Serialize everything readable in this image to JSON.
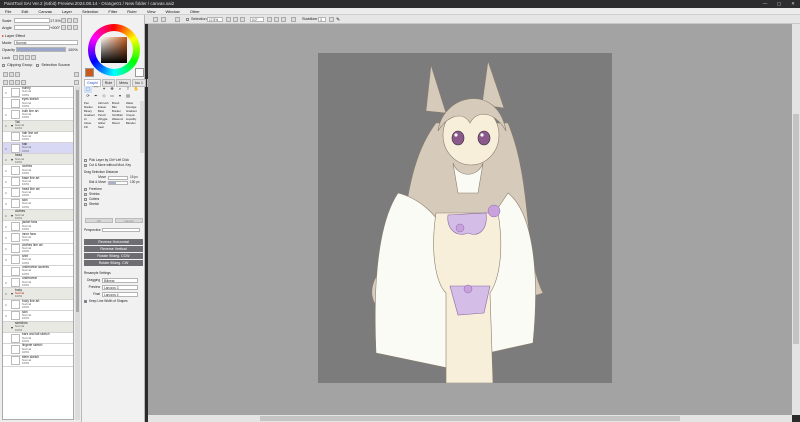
{
  "app": {
    "title": "PaintTool SAI Ver.2 (64bit) Preview.2024.08.14 - Orange01 / New folder / canvas.sai2"
  },
  "window_controls": {
    "minimize": "—",
    "maximize": "▢",
    "close": "✕"
  },
  "menu": [
    "File",
    "Edit",
    "Canvas",
    "Layer",
    "Selection",
    "Filter",
    "Ruler",
    "View",
    "Window",
    "Other"
  ],
  "toolbar": {
    "selection_label": "Selection",
    "zoom": "17.5%",
    "angle": "0.0°",
    "stabilizer_label": "Stabilizer",
    "stabilizer_value": "3"
  },
  "left_panel": {
    "rows": [
      {
        "label": "Scale",
        "value": "17.5%"
      },
      {
        "label": "Angle",
        "value": "+000°"
      }
    ],
    "layer_effect": "Layer Effect",
    "mode_label": "Mode",
    "mode_value": "Normal",
    "opacity_label": "Opacity",
    "opacity_value": "100%",
    "lock_label": "Lock",
    "clipping_group": "Clipping Group",
    "selection_source": "Selection Source",
    "layers": [
      {
        "name": "bunny",
        "mode": "Normal",
        "op": "100%",
        "type": "layer"
      },
      {
        "name": "eyes sketch",
        "mode": "Normal",
        "op": "100%",
        "type": "layer"
      },
      {
        "name": "bulb line art",
        "mode": "Normal",
        "op": "100%",
        "type": "layer"
      },
      {
        "name": "Tail",
        "mode": "Normal",
        "op": "100%",
        "type": "group"
      },
      {
        "name": "hair line art",
        "mode": "Normal",
        "op": "100%",
        "type": "layer"
      },
      {
        "name": "hair",
        "mode": "Normal",
        "op": "100%",
        "type": "selected"
      },
      {
        "name": "head",
        "mode": "Normal",
        "op": "100%",
        "type": "group"
      },
      {
        "name": "clothes",
        "mode": "Normal",
        "op": "100%",
        "type": "layer"
      },
      {
        "name": "base line art",
        "mode": "Normal",
        "op": "100%",
        "type": "layer"
      },
      {
        "name": "head line art",
        "mode": "Normal",
        "op": "100%",
        "type": "layer"
      },
      {
        "name": "skin",
        "mode": "Normal",
        "op": "100%",
        "type": "layer"
      },
      {
        "name": "clothes",
        "mode": "Normal",
        "op": "100%",
        "type": "group"
      },
      {
        "name": "jacket fans",
        "mode": "Normal",
        "op": "100%",
        "type": "layer"
      },
      {
        "name": "inner fans",
        "mode": "Normal",
        "op": "100%",
        "type": "layer"
      },
      {
        "name": "clothes line art",
        "mode": "Normal",
        "op": "100%",
        "type": "layer"
      },
      {
        "name": "shirt",
        "mode": "Normal",
        "op": "100%",
        "type": "layer"
      },
      {
        "name": "underwear accents",
        "mode": "Normal",
        "op": "100%",
        "type": "layer"
      },
      {
        "name": "underwear",
        "mode": "Normal",
        "op": "100%",
        "type": "layer"
      },
      {
        "name": "body",
        "mode": "Normal",
        "op": "100%",
        "type": "group_red"
      },
      {
        "name": "body line art",
        "mode": "Normal",
        "op": "100%",
        "type": "layer"
      },
      {
        "name": "skin",
        "mode": "Normal",
        "op": "100%",
        "type": "layer"
      },
      {
        "name": "sketches",
        "mode": "Normal",
        "op": "100%",
        "type": "group"
      },
      {
        "name": "ears and tail sketch",
        "mode": "Normal",
        "op": "100%",
        "type": "layer"
      },
      {
        "name": "lingerie sketch",
        "mode": "Normal",
        "op": "100%",
        "type": "layer"
      },
      {
        "name": "stem sketch",
        "mode": "Normal",
        "op": "100%",
        "type": "layer"
      }
    ]
  },
  "tool_panel": {
    "tabs": [
      "Graphi",
      "Rule",
      "Menu",
      "Inc 1",
      "Glide"
    ],
    "tools": [
      "Pen",
      "Airbrush",
      "Brush",
      "Water",
      "Marker",
      "Eraser",
      "Blur",
      "Smudge",
      "Binary",
      "Blow",
      "Bucket",
      "Gradient",
      "Gradient",
      "Pencil",
      "Scribbler",
      "Crayon",
      "Ai",
      "Wriggle",
      "Watercol",
      "Liquidify",
      "Close",
      "Glitter",
      "Mixed",
      "Blender",
      "Fill",
      "Seal"
    ],
    "pick_layer": "Pick Layer by Ctrl+Left Click",
    "cut_move": "Cut & Move without Mod. Key",
    "drag_label": "Drag Selection Distance",
    "move_label": "Move",
    "move_value": "15 px",
    "dist_label": "Dist & Move",
    "dist_value": "130 px",
    "checks": [
      "Freeform",
      "Shrinks",
      "Cutters",
      "Stretch"
    ],
    "ok_label": "OK",
    "cancel_label": "Cancel",
    "perspective_label": "Perspective",
    "btn_reverse_h": "Reverse Horizontal",
    "btn_reverse_v": "Reverse Vertical",
    "btn_rotate_ccw": "Rotate 90deg. CCW",
    "btn_rotate_cw": "Rotate 90deg. CW",
    "sampling_header": "Resample Settings",
    "dragging_label": "Dragging",
    "dragging_value": "Bilinear",
    "preview_label": "Preview",
    "preview_value": "Lanczos 3",
    "final_label": "Final",
    "final_value": "Lanczos 4",
    "keep_line": "Keep Line Width of Shapes"
  },
  "colors": {
    "primary": "#c85a1a",
    "secondary": "#ffffff",
    "selected_row": "#d8d8f4",
    "canvas_bg": "#a3a3a3",
    "paper": "#7c7c7c"
  }
}
